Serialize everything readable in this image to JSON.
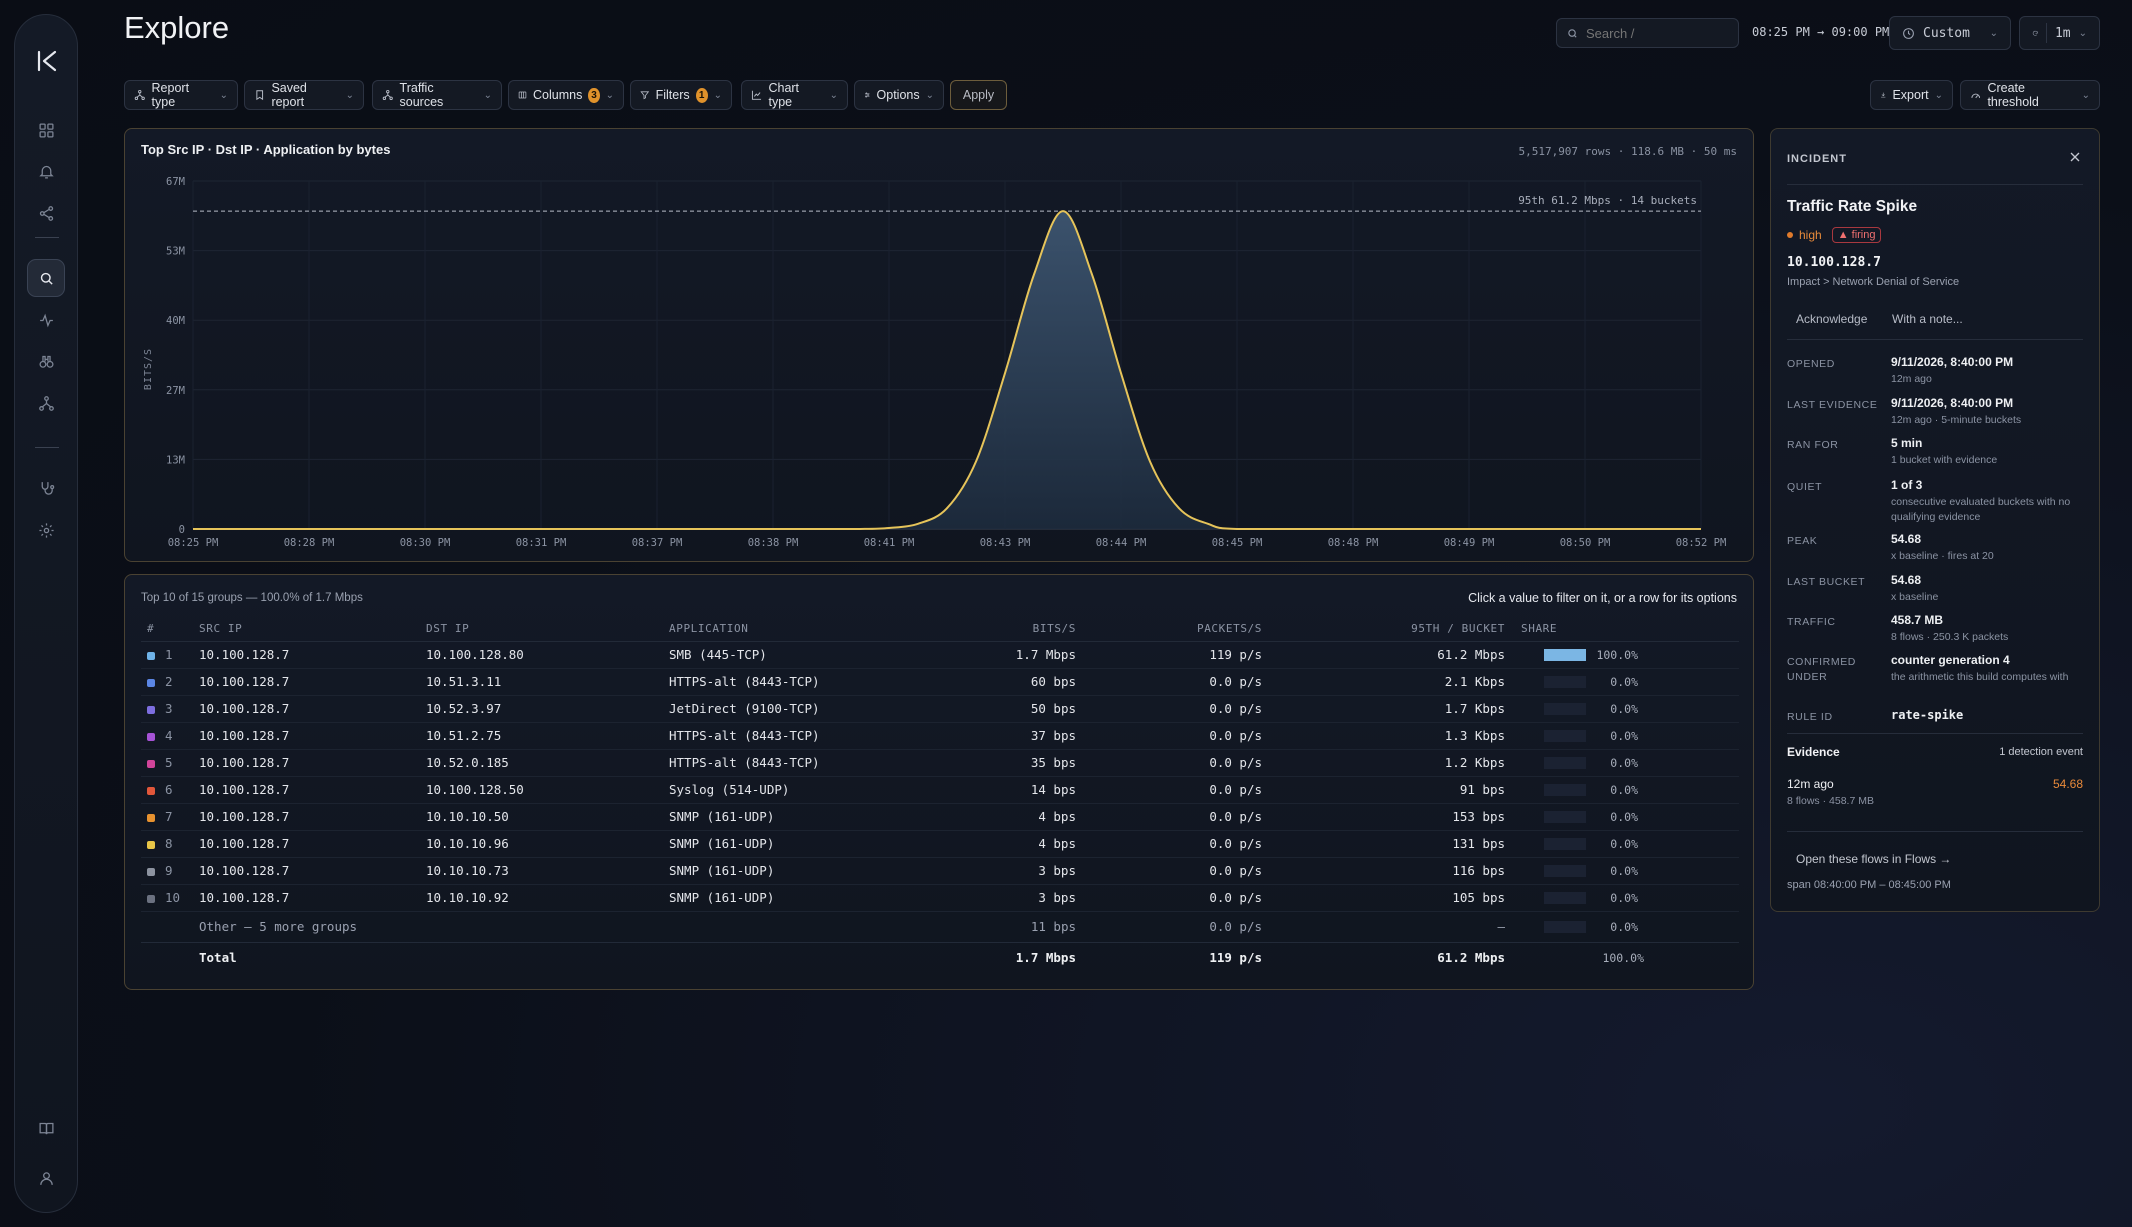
{
  "page": {
    "title": "Explore"
  },
  "header": {
    "search_placeholder": "Search /",
    "time_range": "08:25 PM → 09:00 PM",
    "range_label": "Custom",
    "refresh_interval": "1m"
  },
  "sidebar": {
    "items": [
      {
        "icon": "grid-icon"
      },
      {
        "icon": "bell-icon"
      },
      {
        "icon": "share-icon"
      },
      {
        "icon": "search-icon",
        "active": true
      },
      {
        "icon": "pulse-icon"
      },
      {
        "icon": "binoculars-icon"
      },
      {
        "icon": "topology-icon"
      },
      {
        "icon": "stethoscope-icon"
      },
      {
        "icon": "gear-icon"
      },
      {
        "icon": "book-icon"
      },
      {
        "icon": "user-icon"
      }
    ]
  },
  "toolbar": {
    "report_type": "Report type",
    "saved_report": "Saved report",
    "traffic_sources": "Traffic sources",
    "columns": "Columns",
    "columns_count": "3",
    "filters": "Filters",
    "filters_count": "1",
    "chart_type": "Chart type",
    "options": "Options",
    "apply": "Apply",
    "export": "Export",
    "create_threshold": "Create threshold"
  },
  "chart": {
    "title": "Top Src IP · Dst IP · Application by bytes",
    "meta": "5,517,907 rows · 118.6 MB · 50 ms",
    "percentile_label": "95th 61.2 Mbps · 14 buckets"
  },
  "chart_data": {
    "type": "area",
    "ylabel": "BITS/S",
    "y_ticks": [
      "67M",
      "53M",
      "40M",
      "27M",
      "13M",
      "0"
    ],
    "ylim": [
      0,
      67
    ],
    "x_ticks": [
      "08:25 PM",
      "08:28 PM",
      "08:30 PM",
      "08:31 PM",
      "08:37 PM",
      "08:38 PM",
      "08:41 PM",
      "08:43 PM",
      "08:44 PM",
      "08:45 PM",
      "08:48 PM",
      "08:49 PM",
      "08:50 PM",
      "08:52 PM"
    ],
    "threshold": 61.2,
    "series": [
      {
        "x": [
          0,
          1,
          2,
          3,
          4,
          5,
          5.25,
          5.5,
          5.75,
          6,
          6.25,
          6.5,
          6.75,
          7,
          7.25,
          7.5,
          7.75,
          8,
          8.25,
          8.5,
          8.75,
          9,
          10,
          11,
          12,
          13
        ],
        "values": [
          0,
          0,
          0,
          0,
          0,
          0,
          0,
          0,
          0,
          0.2,
          1,
          4,
          13,
          30,
          49,
          61.2,
          49,
          30,
          13,
          4,
          1,
          0,
          0,
          0,
          0,
          0
        ]
      }
    ],
    "grid": true
  },
  "table": {
    "summary": "Top 10 of 15 groups — 100.0% of 1.7 Mbps",
    "hint": "Click a value to filter on it, or a row for its options",
    "headers": {
      "idx": "#",
      "src": "SRC IP",
      "dst": "DST IP",
      "app": "APPLICATION",
      "bits": "BITS/S",
      "pkts": "PACKETS/S",
      "p95": "95TH / BUCKET",
      "share": "SHARE"
    },
    "rows": [
      {
        "n": "1",
        "color": "#6fb3e8",
        "src": "10.100.128.7",
        "dst": "10.100.128.80",
        "app": "SMB (445-TCP)",
        "bits": "1.7 Mbps",
        "pkts": "119 p/s",
        "p95": "61.2 Mbps",
        "share": 1.0,
        "share_label": "100.0%"
      },
      {
        "n": "2",
        "color": "#5b86e5",
        "src": "10.100.128.7",
        "dst": "10.51.3.11",
        "app": "HTTPS-alt (8443-TCP)",
        "bits": "60 bps",
        "pkts": "0.0 p/s",
        "p95": "2.1 Kbps",
        "share": 0.0,
        "share_label": "0.0%"
      },
      {
        "n": "3",
        "color": "#7d6ee0",
        "src": "10.100.128.7",
        "dst": "10.52.3.97",
        "app": "JetDirect (9100-TCP)",
        "bits": "50 bps",
        "pkts": "0.0 p/s",
        "p95": "1.7 Kbps",
        "share": 0.0,
        "share_label": "0.0%"
      },
      {
        "n": "4",
        "color": "#a653d6",
        "src": "10.100.128.7",
        "dst": "10.51.2.75",
        "app": "HTTPS-alt (8443-TCP)",
        "bits": "37 bps",
        "pkts": "0.0 p/s",
        "p95": "1.3 Kbps",
        "share": 0.0,
        "share_label": "0.0%"
      },
      {
        "n": "5",
        "color": "#d1449a",
        "src": "10.100.128.7",
        "dst": "10.52.0.185",
        "app": "HTTPS-alt (8443-TCP)",
        "bits": "35 bps",
        "pkts": "0.0 p/s",
        "p95": "1.2 Kbps",
        "share": 0.0,
        "share_label": "0.0%"
      },
      {
        "n": "6",
        "color": "#e2573a",
        "src": "10.100.128.7",
        "dst": "10.100.128.50",
        "app": "Syslog (514-UDP)",
        "bits": "14 bps",
        "pkts": "0.0 p/s",
        "p95": "91 bps",
        "share": 0.0,
        "share_label": "0.0%"
      },
      {
        "n": "7",
        "color": "#e8922f",
        "src": "10.100.128.7",
        "dst": "10.10.10.50",
        "app": "SNMP (161-UDP)",
        "bits": "4 bps",
        "pkts": "0.0 p/s",
        "p95": "153 bps",
        "share": 0.0,
        "share_label": "0.0%"
      },
      {
        "n": "8",
        "color": "#e8c547",
        "src": "10.100.128.7",
        "dst": "10.10.10.96",
        "app": "SNMP (161-UDP)",
        "bits": "4 bps",
        "pkts": "0.0 p/s",
        "p95": "131 bps",
        "share": 0.0,
        "share_label": "0.0%"
      },
      {
        "n": "9",
        "color": "#8d93a0",
        "src": "10.100.128.7",
        "dst": "10.10.10.73",
        "app": "SNMP (161-UDP)",
        "bits": "3 bps",
        "pkts": "0.0 p/s",
        "p95": "116 bps",
        "share": 0.0,
        "share_label": "0.0%"
      },
      {
        "n": "10",
        "color": "#6b7180",
        "src": "10.100.128.7",
        "dst": "10.10.10.92",
        "app": "SNMP (161-UDP)",
        "bits": "3 bps",
        "pkts": "0.0 p/s",
        "p95": "105 bps",
        "share": 0.0,
        "share_label": "0.0%"
      }
    ],
    "other": {
      "label": "Other — 5 more groups",
      "bits": "11 bps",
      "pkts": "0.0 p/s",
      "p95": "—",
      "share_label": "0.0%"
    },
    "total": {
      "label": "Total",
      "bits": "1.7 Mbps",
      "pkts": "119 p/s",
      "p95": "61.2 Mbps",
      "share_label": "100.0%"
    }
  },
  "incident": {
    "header": "INCIDENT",
    "title": "Traffic Rate Spike",
    "severity": "high",
    "status": "firing",
    "ip": "10.100.128.7",
    "impact": "Impact > Network Denial of Service",
    "acknowledge": "Acknowledge",
    "with_note": "With a note...",
    "fields": [
      {
        "k": "OPENED",
        "v": "9/11/2026, 8:40:00 PM",
        "s": "12m ago"
      },
      {
        "k": "LAST EVIDENCE",
        "v": "9/11/2026, 8:40:00 PM",
        "s": "12m ago · 5-minute buckets"
      },
      {
        "k": "RAN FOR",
        "v": "5 min",
        "s": "1 bucket with evidence"
      },
      {
        "k": "QUIET",
        "v": "1 of 3",
        "s": "consecutive evaluated buckets with no qualifying evidence"
      },
      {
        "k": "PEAK",
        "v": "54.68",
        "s": "x baseline · fires at 20"
      },
      {
        "k": "LAST BUCKET",
        "v": "54.68",
        "s": "x baseline"
      },
      {
        "k": "TRAFFIC",
        "v": "458.7 MB",
        "s": "8 flows · 250.3 K packets"
      },
      {
        "k": "CONFIRMED UNDER",
        "v": "counter generation 4",
        "s": "the arithmetic this build computes with"
      },
      {
        "k": "RULE ID",
        "v": "rate-spike",
        "s": ""
      }
    ],
    "evidence_title": "Evidence",
    "evidence_count": "1 detection event",
    "evidence_time": "12m ago",
    "evidence_value": "54.68",
    "evidence_sub": "8 flows · 458.7 MB",
    "open_flows": "Open these flows in Flows →",
    "span": "span 08:40:00 PM – 08:45:00 PM"
  }
}
